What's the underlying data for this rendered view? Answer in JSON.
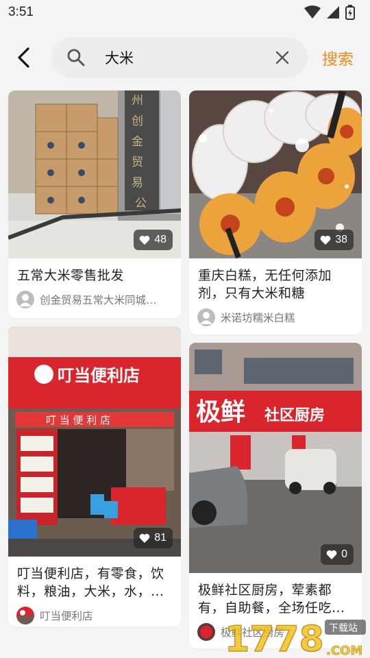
{
  "status_bar": {
    "time": "3:51"
  },
  "search": {
    "query": "大米",
    "action_label": "搜索"
  },
  "feed": {
    "cards": [
      {
        "title": "五常大米零售批发",
        "likes": "48",
        "author": "创金贸易五常大米同城…"
      },
      {
        "title": "重庆白糕，无任何添加剂，只有大米和糖",
        "likes": "38",
        "author": "米诺坊糯米白糕"
      },
      {
        "title": "叮当便利店，有零食，饮料，粮油，大米，水，…",
        "likes": "81",
        "author": "叮当便利店",
        "image_sign": "叮当便利店",
        "image_banner": "叮 当 便 利 店"
      },
      {
        "title": "极鲜社区厨房，荤素都有，自助餐，全场任吃…",
        "likes": "0",
        "author": "极鲜社区厨房",
        "image_sign_big": "极鲜",
        "image_sign_small": "社区厨房"
      }
    ]
  },
  "watermark": {
    "text": "1778",
    "suffix": ".COM",
    "tag": "下载站"
  },
  "colors": {
    "accent": "#f08a1c",
    "sign_red": "#d9262e"
  }
}
